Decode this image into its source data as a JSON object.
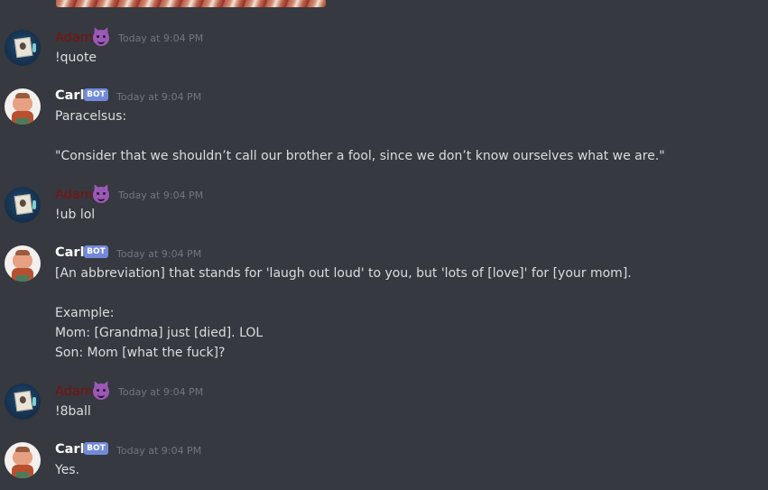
{
  "app": "Discord",
  "messages": [
    {
      "author": "Adam",
      "author_color": "#7e0f0f",
      "emoji": "smiling-imp-emoji",
      "bot": false,
      "timestamp": "Today at 9:04 PM",
      "lines": [
        "!quote"
      ]
    },
    {
      "author": "Carl",
      "bot": true,
      "bot_label": "BOT",
      "timestamp": "Today at 9:04 PM",
      "lines": [
        "Paracelsus:",
        "\"Consider that we shouldn’t call our brother a fool, since we don’t know ourselves what we are.\""
      ]
    },
    {
      "author": "Adam",
      "author_color": "#7e0f0f",
      "emoji": "smiling-imp-emoji",
      "bot": false,
      "timestamp": "Today at 9:04 PM",
      "lines": [
        "!ub lol"
      ]
    },
    {
      "author": "Carl",
      "bot": true,
      "bot_label": "BOT",
      "timestamp": "Today at 9:04 PM",
      "lines": [
        "[An abbreviation] that stands for 'laugh out loud' to you, but 'lots of [love]' for [your mom].",
        "Example:",
        "Mom: [Grandma] just [died]. LOL",
        "Son: Mom [what the fuck]?"
      ]
    },
    {
      "author": "Adam",
      "author_color": "#7e0f0f",
      "emoji": "smiling-imp-emoji",
      "bot": false,
      "timestamp": "Today at 9:04 PM",
      "lines": [
        "!8ball"
      ]
    },
    {
      "author": "Carl",
      "bot": true,
      "bot_label": "BOT",
      "timestamp": "Today at 9:04 PM",
      "lines": [
        "Yes."
      ]
    }
  ],
  "colors": {
    "background": "#36393f",
    "text": "#dcddde",
    "timestamp": "#72767d",
    "bot_tag": "#7289da",
    "author_adam": "#7e0f0f"
  }
}
